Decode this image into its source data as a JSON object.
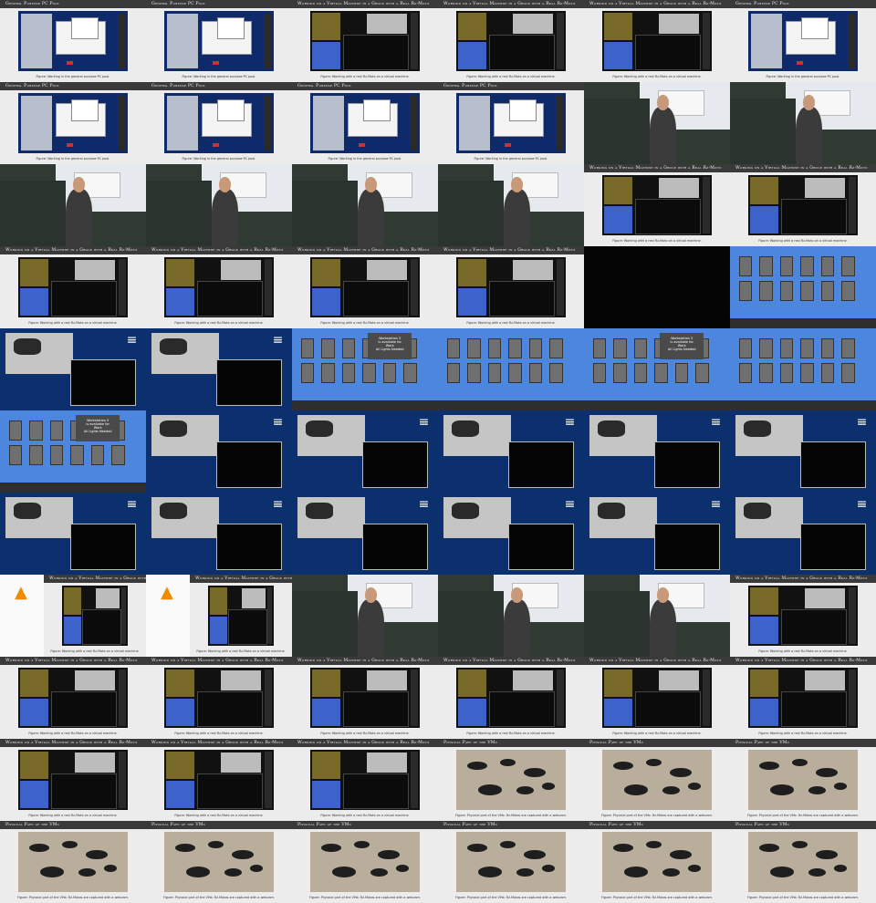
{
  "grid": {
    "cols": 6,
    "rows": 11
  },
  "titles": {
    "pool": "General Purpose PC Pool",
    "rz": "Working on a Virtual Machine in a Group with a Real Rz-Moto",
    "phys": "Physical Part of the VMs"
  },
  "captions": {
    "pool": "Figure: Working in the general purpose PC pool.",
    "rz": "Figure: Working with a real Rz-Moto on a virtual machine.",
    "phys": "Figure: Physical part of the VMs: Rz-Motos are captured with a webcam."
  },
  "game": {
    "dialog_lines": [
      "Workstation 5",
      "is available for",
      "Work",
      "All Lights Needed"
    ]
  },
  "tiles": [
    [
      "pool",
      "pool",
      "rz",
      "rz",
      "rz",
      "pool"
    ],
    [
      "pool",
      "pool",
      "pool",
      "pool",
      "lecture",
      "lecture"
    ],
    [
      "lecture",
      "lecture",
      "lecture",
      "lecture",
      "rz",
      "rz"
    ],
    [
      "rz",
      "rz",
      "rz",
      "rz",
      "black",
      "game"
    ],
    [
      "desk",
      "desk",
      "game",
      "game",
      "game",
      "game"
    ],
    [
      "game",
      "desk",
      "desk",
      "desk",
      "desk",
      "desk"
    ],
    [
      "desk",
      "desk",
      "desk",
      "desk",
      "desk",
      "desk"
    ],
    [
      "vlc",
      "vlc",
      "lecture",
      "lecture",
      "lecture",
      "rz"
    ],
    [
      "rz",
      "rz",
      "rz",
      "rz",
      "rz",
      "rz"
    ],
    [
      "rz",
      "rz",
      "rz",
      "phys",
      "phys",
      "phys"
    ],
    [
      "phys",
      "phys",
      "phys",
      "phys",
      "phys",
      "phys"
    ]
  ]
}
